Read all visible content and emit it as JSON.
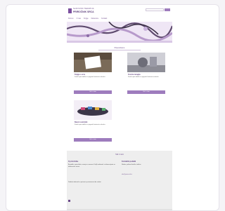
{
  "header": {
    "brand_top": "SLIKOVNO TERAPIJA",
    "brand_main": "PRIROČNIK SRCA",
    "search_button": "Išči"
  },
  "nav": [
    "Domov",
    "O nas",
    "Knjige",
    "Delavnice",
    "Kontakt"
  ],
  "section_title": "Priporočamo",
  "products": [
    {
      "title": "Knjiga o srcu",
      "desc": "Kratek opis izdelka in njegovih lastnosti za bralca.",
      "button": "Več o tem"
    },
    {
      "title": "Zvočna terapija",
      "desc": "Kratek opis izdelka in njegovih lastnosti za bralca.",
      "button": "Več o tem"
    },
    {
      "title": "Barvni svinčniki",
      "desc": "Kratek opis izdelka in njegovih lastnosti za bralca.",
      "button": "Več o tem"
    }
  ],
  "footer": {
    "title": "Stik z nami",
    "left_title": "O priročniku",
    "left_text": "Besedilo o priročniku, avtorju in namenu. Daljši odstavek z informacijami za obiskovalce strani.",
    "left_text2": "Dodatni odstavek z opisom in povezavami do vsebin.",
    "right_title": "Kontaktni podatki",
    "right_text": "Naslov, poštna številka, telefon",
    "right_link": "info@prirocnik.si"
  },
  "colors": {
    "accent": "#9e7cbd",
    "brand": "#5d3f7c"
  }
}
